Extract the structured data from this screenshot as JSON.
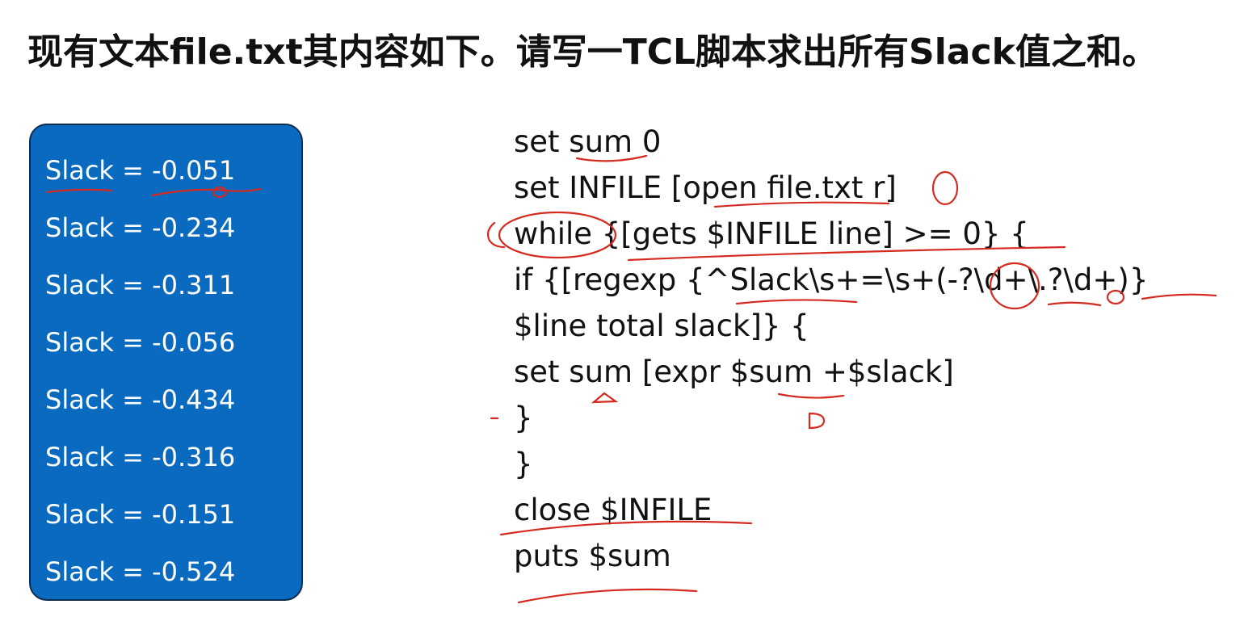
{
  "title": "现有文本file.txt其内容如下。请写一TCL脚本求出所有Slack值之和。",
  "file_content": {
    "lines": [
      "Slack = -0.051",
      "Slack = -0.234",
      "Slack = -0.311",
      "Slack = -0.056",
      "Slack = -0.434",
      "Slack = -0.316",
      "Slack = -0.151",
      "Slack = -0.524"
    ]
  },
  "code": {
    "lines": [
      "set sum 0",
      "set INFILE [open file.txt r]",
      "while {[gets $INFILE line] >= 0} {",
      "if {[regexp {^Slack\\s+=\\s+(-?\\d+\\.?\\d+)}",
      "$line total slack]} {",
      "set sum [expr $sum +$slack]",
      "}",
      "}",
      "close $INFILE",
      "puts $sum"
    ]
  },
  "colors": {
    "file_box_fill": "#0a6ac0",
    "file_box_text": "#ffffff",
    "annotation_ink": "#d42a20",
    "text": "#111111"
  }
}
